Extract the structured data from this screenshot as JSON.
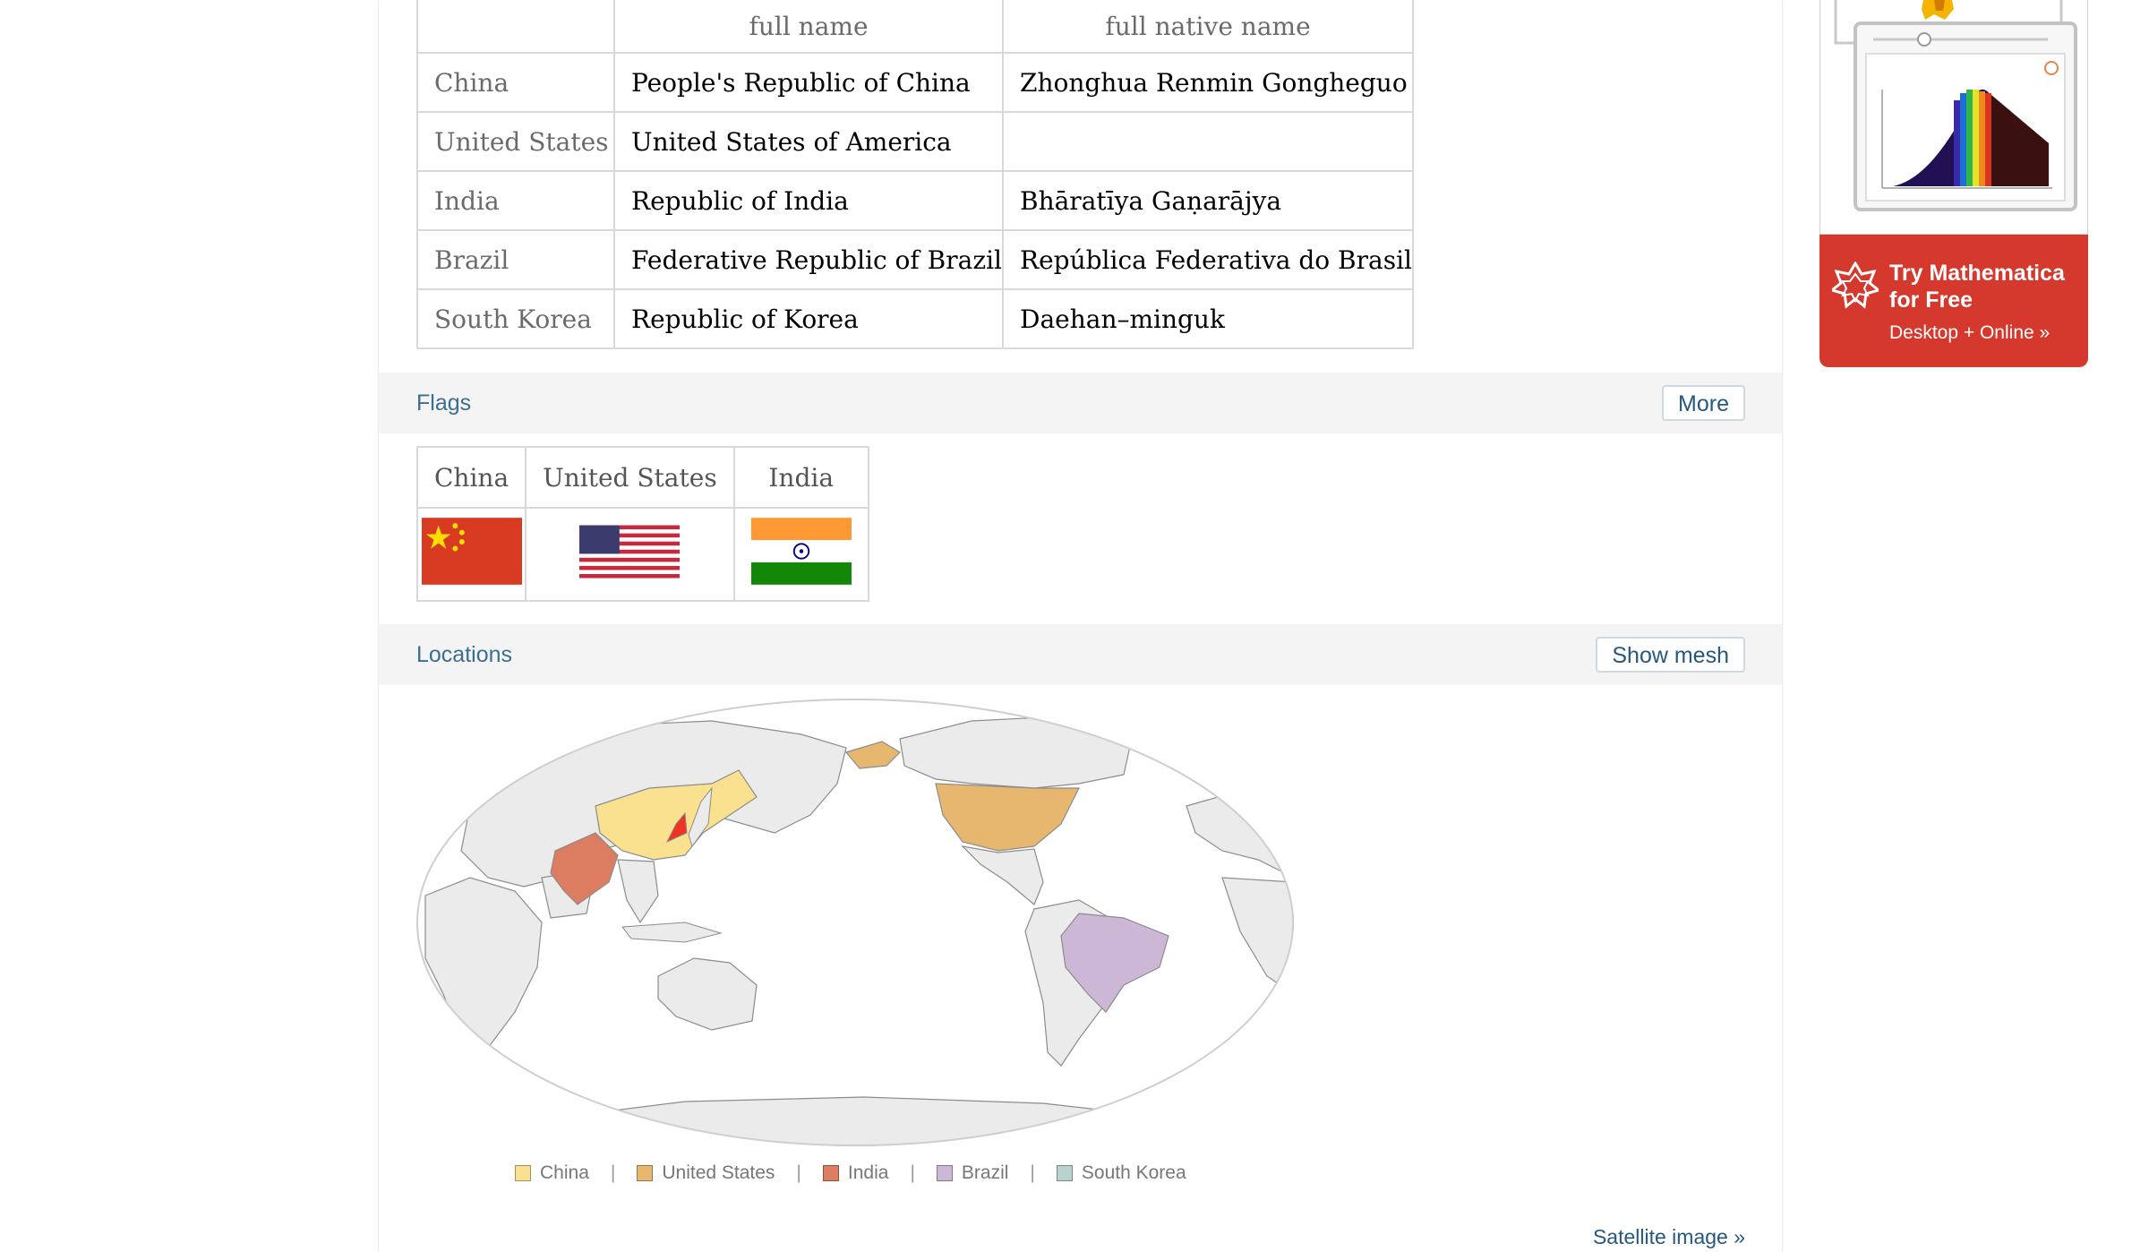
{
  "names_table": {
    "headers": [
      "",
      "full name",
      "full native name"
    ],
    "rows": [
      {
        "country": "China",
        "full_name": "People's Republic of China",
        "native": "Zhonghua Renmin Gongheguo"
      },
      {
        "country": "United States",
        "full_name": "United States of America",
        "native": ""
      },
      {
        "country": "India",
        "full_name": "Republic of India",
        "native": "Bhāratīya Gaṇarājya"
      },
      {
        "country": "Brazil",
        "full_name": "Federative Republic of Brazil",
        "native": "República Federativa do Brasil"
      },
      {
        "country": "South Korea",
        "full_name": "Republic of Korea",
        "native": "Daehan–minguk"
      }
    ]
  },
  "flags_pod": {
    "title": "Flags",
    "button": "More",
    "countries": [
      "China",
      "United States",
      "India"
    ]
  },
  "locations_pod": {
    "title": "Locations",
    "button": "Show mesh",
    "legend": [
      {
        "label": "China",
        "color": "#f9e18f"
      },
      {
        "label": "United States",
        "color": "#e8b76f"
      },
      {
        "label": "India",
        "color": "#dc7c60"
      },
      {
        "label": "Brazil",
        "color": "#cdb7d6"
      },
      {
        "label": "South Korea",
        "color": "#b8d3cf"
      }
    ],
    "satellite_link": "Satellite image »"
  },
  "ad": {
    "title_line1": "Try Mathematica",
    "title_line2": "for Free",
    "subtitle": "Desktop + Online »"
  }
}
